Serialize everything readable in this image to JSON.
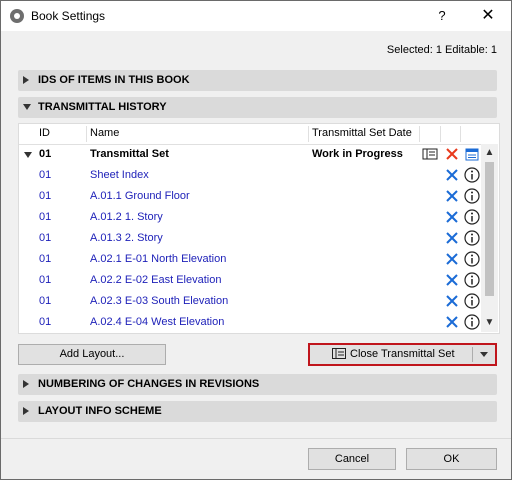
{
  "window": {
    "title": "Book Settings",
    "help_label": "?",
    "close_label": "✕"
  },
  "status_text": "Selected: 1 Editable: 1",
  "sections": {
    "ids": "IDS OF ITEMS IN THIS BOOK",
    "transmittal": "TRANSMITTAL HISTORY",
    "numbering": "NUMBERING OF CHANGES IN REVISIONS",
    "layout_info": "LAYOUT INFO SCHEME"
  },
  "table": {
    "columns": {
      "id": "ID",
      "name": "Name",
      "date": "Transmittal Set Date"
    },
    "parent": {
      "id": "01",
      "name": "Transmittal Set",
      "date": "Work in Progress"
    },
    "rows": [
      {
        "id": "01",
        "name": "Sheet Index"
      },
      {
        "id": "01",
        "name": "A.01.1 Ground Floor"
      },
      {
        "id": "01",
        "name": "A.01.2 1. Story"
      },
      {
        "id": "01",
        "name": "A.01.3 2. Story"
      },
      {
        "id": "01",
        "name": "A.02.1 E-01 North Elevation"
      },
      {
        "id": "01",
        "name": "A.02.2 E-02 East Elevation"
      },
      {
        "id": "01",
        "name": "A.02.3 E-03 South Elevation"
      },
      {
        "id": "01",
        "name": "A.02.4 E-04 West Elevation"
      }
    ]
  },
  "buttons": {
    "add_layout": "Add Layout...",
    "close_transmittal": "Close Transmittal Set",
    "cancel": "Cancel",
    "ok": "OK"
  },
  "colors": {
    "accent_red": "#c0151c",
    "link_blue": "#1c1fb8",
    "icon_blue": "#1b6bd6",
    "delete_red": "#e8391c"
  }
}
